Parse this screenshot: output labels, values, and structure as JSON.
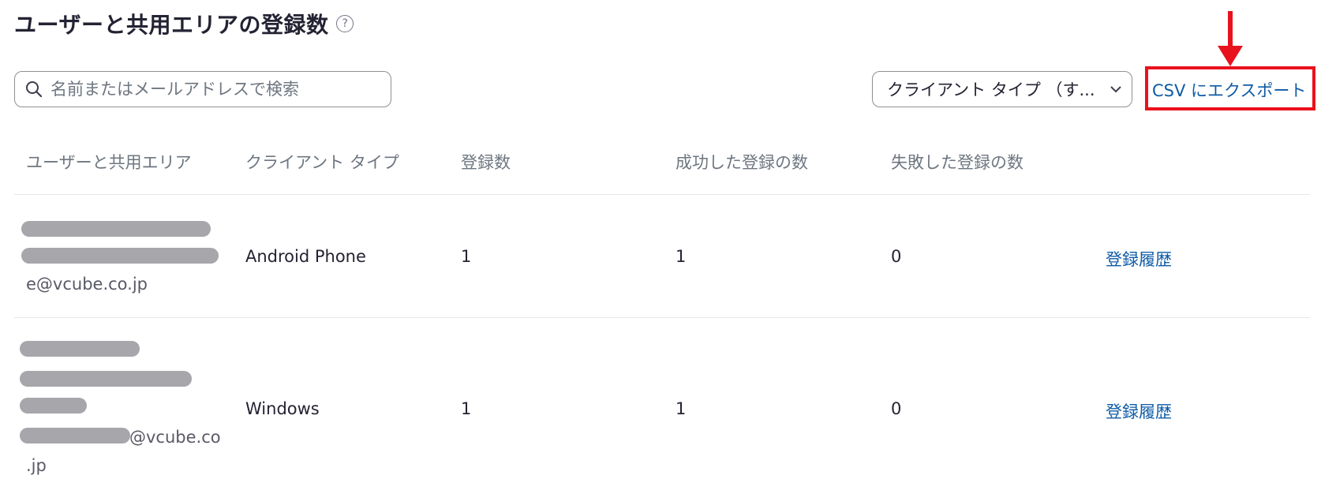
{
  "title": "ユーザーと共用エリアの登録数",
  "help_icon": "?",
  "search": {
    "placeholder": "名前またはメールアドレスで検索",
    "value": ""
  },
  "filter": {
    "label": "クライアント タイプ （す..."
  },
  "export_label": "CSV にエクスポート",
  "highlight_color": "#e8121d",
  "link_color": "#0e5ba6",
  "columns": [
    "ユーザーと共用エリア",
    "クライアント タイプ",
    "登録数",
    "成功した登録の数",
    "失敗した登録の数"
  ],
  "rows": [
    {
      "user_visible": [
        "e@vcube.co.jp"
      ],
      "client_type": "Android Phone",
      "registrations": "1",
      "succeeded": "1",
      "failed": "0",
      "history": "登録履歴"
    },
    {
      "user_visible": [
        "@vcube.co",
        ".jp"
      ],
      "client_type": "Windows",
      "registrations": "1",
      "succeeded": "1",
      "failed": "0",
      "history": "登録履歴"
    }
  ]
}
